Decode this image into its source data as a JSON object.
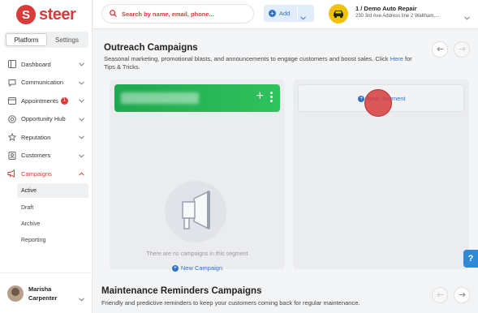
{
  "brand": {
    "logo_letter": "S",
    "name": "steer"
  },
  "sidebar": {
    "tabs": [
      {
        "label": "Platform"
      },
      {
        "label": "Settings"
      }
    ],
    "items": [
      {
        "label": "Dashboard",
        "icon": "dashboard-icon"
      },
      {
        "label": "Communication",
        "icon": "chat-icon"
      },
      {
        "label": "Appointments",
        "icon": "calendar-icon",
        "badge": "1"
      },
      {
        "label": "Opportunity Hub",
        "icon": "target-icon"
      },
      {
        "label": "Reputation",
        "icon": "star-icon"
      },
      {
        "label": "Customers",
        "icon": "contacts-icon"
      },
      {
        "label": "Campaigns",
        "icon": "megaphone-icon"
      }
    ],
    "sub_items": [
      {
        "label": "Active"
      },
      {
        "label": "Draft"
      },
      {
        "label": "Archive"
      },
      {
        "label": "Reporting"
      }
    ],
    "user": {
      "first": "Marisha",
      "last": "Carpenter"
    }
  },
  "topbar": {
    "search_placeholder": "Search by name, email, phone...",
    "add_label": "Add",
    "business_name": "1 / Demo Auto Repair",
    "business_address": "230 3rd Ave Address line 2 Waltham,..."
  },
  "outreach": {
    "title": "Outreach Campaigns",
    "desc_before": "Seasonal marketing, promotional blasts, and announcements to engage customers and boost sales. Click ",
    "desc_link": "Here",
    "desc_after": " for Tips & Tricks.",
    "empty_text": "There are no campaigns in this segment",
    "new_campaign": "New Campaign",
    "new_segment": "New Segment"
  },
  "maintenance": {
    "title": "Maintenance Reminders Campaigns",
    "desc": "Friendly and predictive reminders to keep your customers coming back for regular maintenance."
  },
  "help_label": "?",
  "colors": {
    "brand": "#d93a3a",
    "accent": "#2f73c9",
    "segment_green": "#1ea84f"
  }
}
